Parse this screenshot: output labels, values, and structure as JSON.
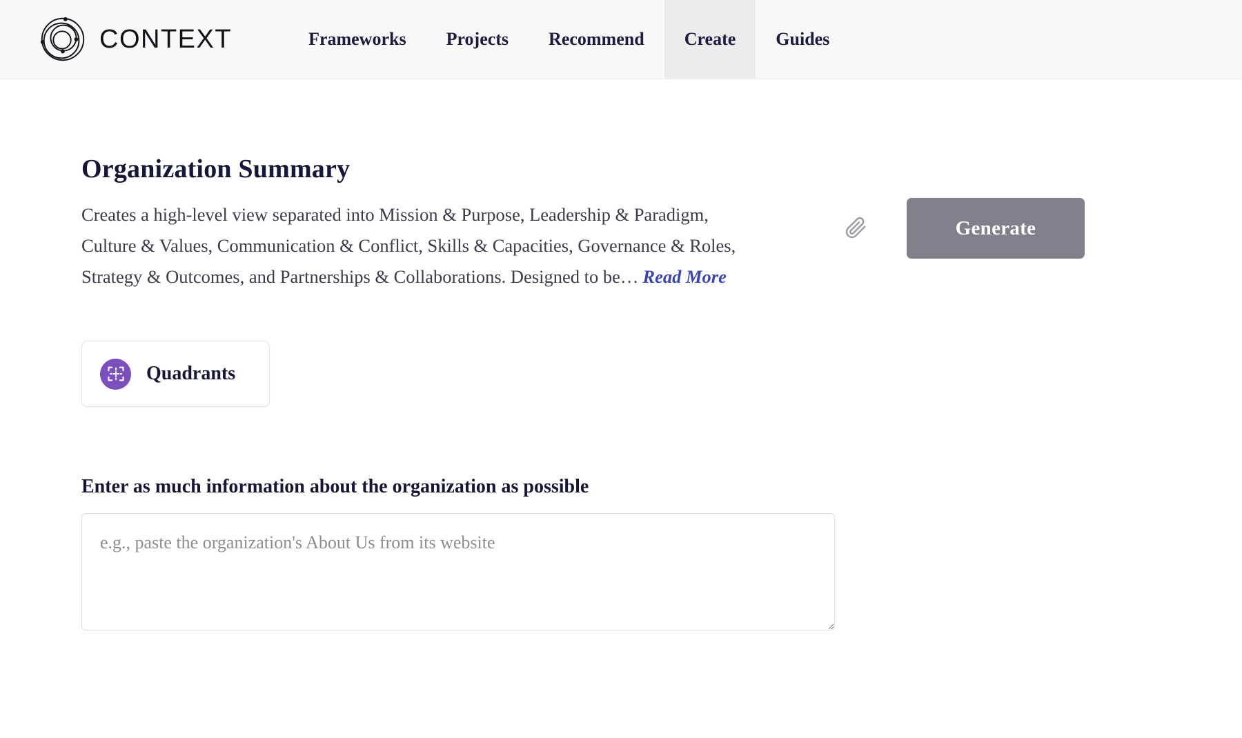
{
  "brand": {
    "name": "CONTEXT",
    "logo_icon": "orbital-rings-logo-icon"
  },
  "nav": {
    "items": [
      {
        "label": "Frameworks",
        "active": false
      },
      {
        "label": "Projects",
        "active": false
      },
      {
        "label": "Recommend",
        "active": false
      },
      {
        "label": "Create",
        "active": true
      },
      {
        "label": "Guides",
        "active": false
      }
    ]
  },
  "main": {
    "title": "Organization Summary",
    "description": "Creates a high-level view separated into Mission & Purpose, Leadership & Paradigm, Culture & Values, Communication & Conflict, Skills & Capacities, Governance & Roles, Strategy & Outcomes, and Partnerships & Collaborations. Designed to be…",
    "read_more_label": "Read More",
    "attach_icon": "paperclip-icon",
    "generate_label": "Generate",
    "mode_card": {
      "label": "Quadrants",
      "icon": "quadrants-grid-icon"
    },
    "field": {
      "label": "Enter as much information about the organization as possible",
      "placeholder": "e.g., paste the organization's About Us from its website",
      "value": ""
    }
  },
  "colors": {
    "navy": "#161636",
    "link_blue": "#3a45b4",
    "purple": "#7c4fbe",
    "button_gray": "#807f8c",
    "nav_bg": "#f8f8f9",
    "nav_active_bg": "#ececec"
  }
}
